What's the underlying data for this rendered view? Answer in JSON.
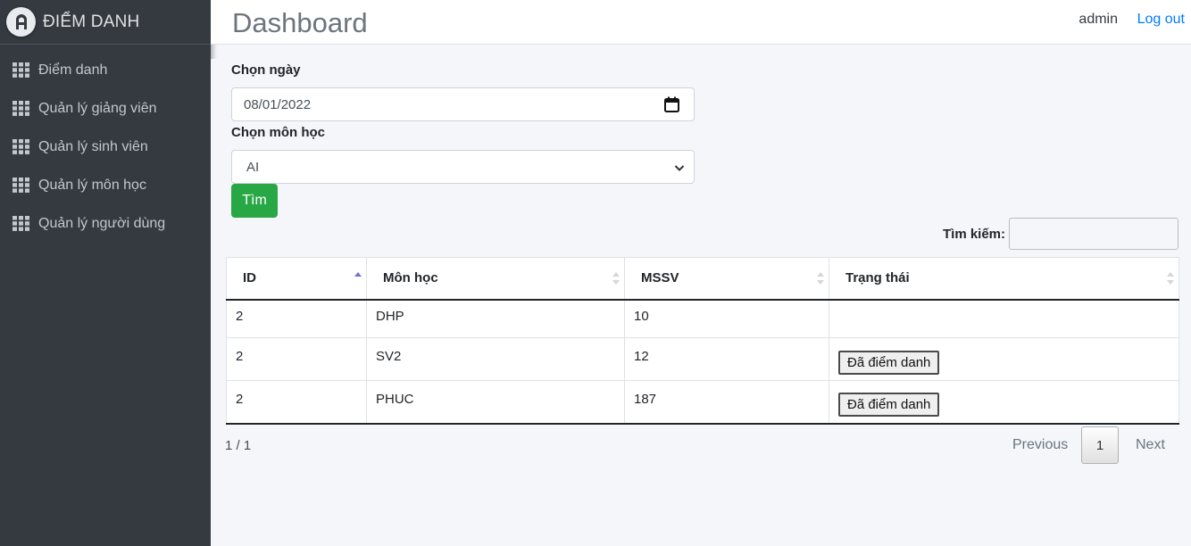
{
  "brand": {
    "title": "ĐIỂM DANH",
    "logo_icon": "logo-a-icon"
  },
  "sidebar": {
    "items": [
      {
        "label": "Điểm danh",
        "icon": "grid-icon"
      },
      {
        "label": "Quản lý giảng viên",
        "icon": "grid-icon"
      },
      {
        "label": "Quản lý sinh viên",
        "icon": "grid-icon"
      },
      {
        "label": "Quản lý môn học",
        "icon": "grid-icon"
      },
      {
        "label": "Quản lý người dùng",
        "icon": "grid-icon"
      }
    ]
  },
  "header": {
    "title": "Dashboard",
    "user": "admin",
    "logout": "Log out"
  },
  "form": {
    "date_label": "Chọn ngày",
    "date_value": "08/01/2022",
    "subject_label": "Chọn môn học",
    "subject_value": "AI",
    "submit_label": "Tìm"
  },
  "search": {
    "label": "Tìm kiếm:"
  },
  "table": {
    "headers": [
      "ID",
      "Môn học",
      "MSSV",
      "Trạng thái"
    ],
    "rows": [
      {
        "id": "2",
        "subject": "DHP",
        "mssv": "10",
        "status": ""
      },
      {
        "id": "2",
        "subject": "SV2",
        "mssv": "12",
        "status": "Đã điểm danh"
      },
      {
        "id": "2",
        "subject": "PHUC",
        "mssv": "187",
        "status": "Đã điểm danh"
      }
    ]
  },
  "pagination": {
    "info": "1 / 1",
    "previous": "Previous",
    "current": "1",
    "next": "Next"
  },
  "colors": {
    "sidebar_bg": "#343a40",
    "accent": "#007bff",
    "success": "#28a745"
  }
}
